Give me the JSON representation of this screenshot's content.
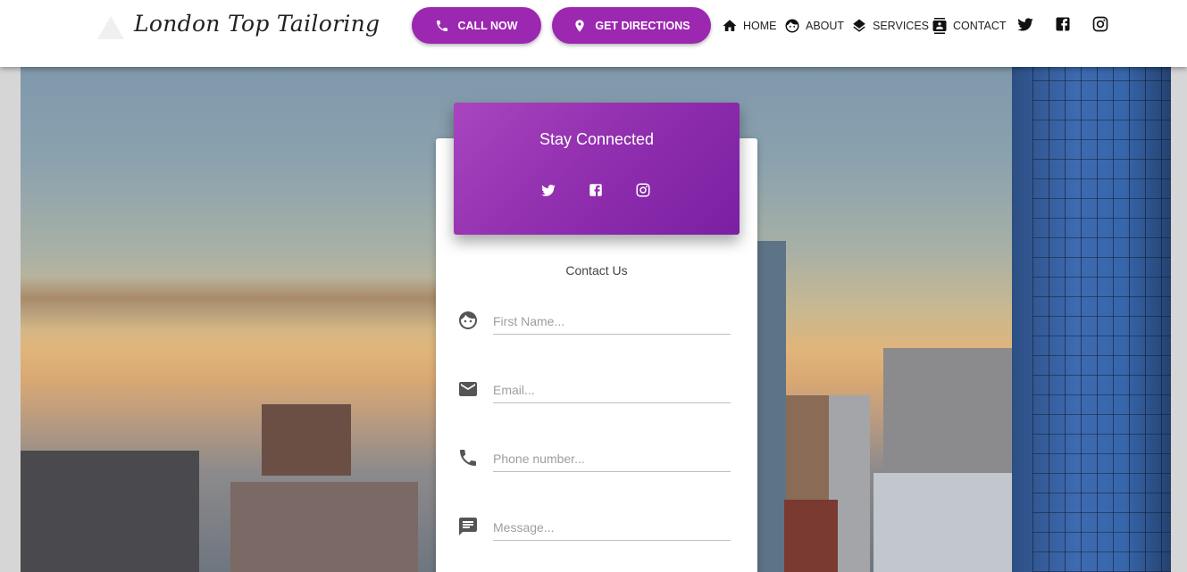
{
  "brand": {
    "name": "London Top Tailoring"
  },
  "header": {
    "call_label": "CALL NOW",
    "directions_label": "GET DIRECTIONS",
    "nav": [
      {
        "label": "HOME",
        "icon": "home-icon"
      },
      {
        "label": "ABOUT",
        "icon": "face-icon"
      },
      {
        "label": "SERVICES",
        "icon": "layers-icon"
      },
      {
        "label": "CONTACT",
        "icon": "contacts-icon"
      }
    ],
    "social": [
      "twitter-icon",
      "facebook-icon",
      "instagram-icon"
    ]
  },
  "contact_card": {
    "header_title": "Stay Connected",
    "social": [
      "twitter-icon",
      "facebook-icon",
      "instagram-icon"
    ],
    "subtitle": "Contact Us",
    "fields": {
      "first_name": {
        "placeholder": "First Name...",
        "value": "",
        "icon": "face-icon"
      },
      "email": {
        "placeholder": "Email...",
        "value": "",
        "icon": "mail-icon"
      },
      "phone": {
        "placeholder": "Phone number...",
        "value": "",
        "icon": "phone-icon"
      },
      "message": {
        "placeholder": "Message...",
        "value": "",
        "icon": "message-icon"
      }
    }
  },
  "colors": {
    "accent": "#9c27b0",
    "accent_dark": "#7b1fa2",
    "navbar_bg": "#ffffff"
  }
}
